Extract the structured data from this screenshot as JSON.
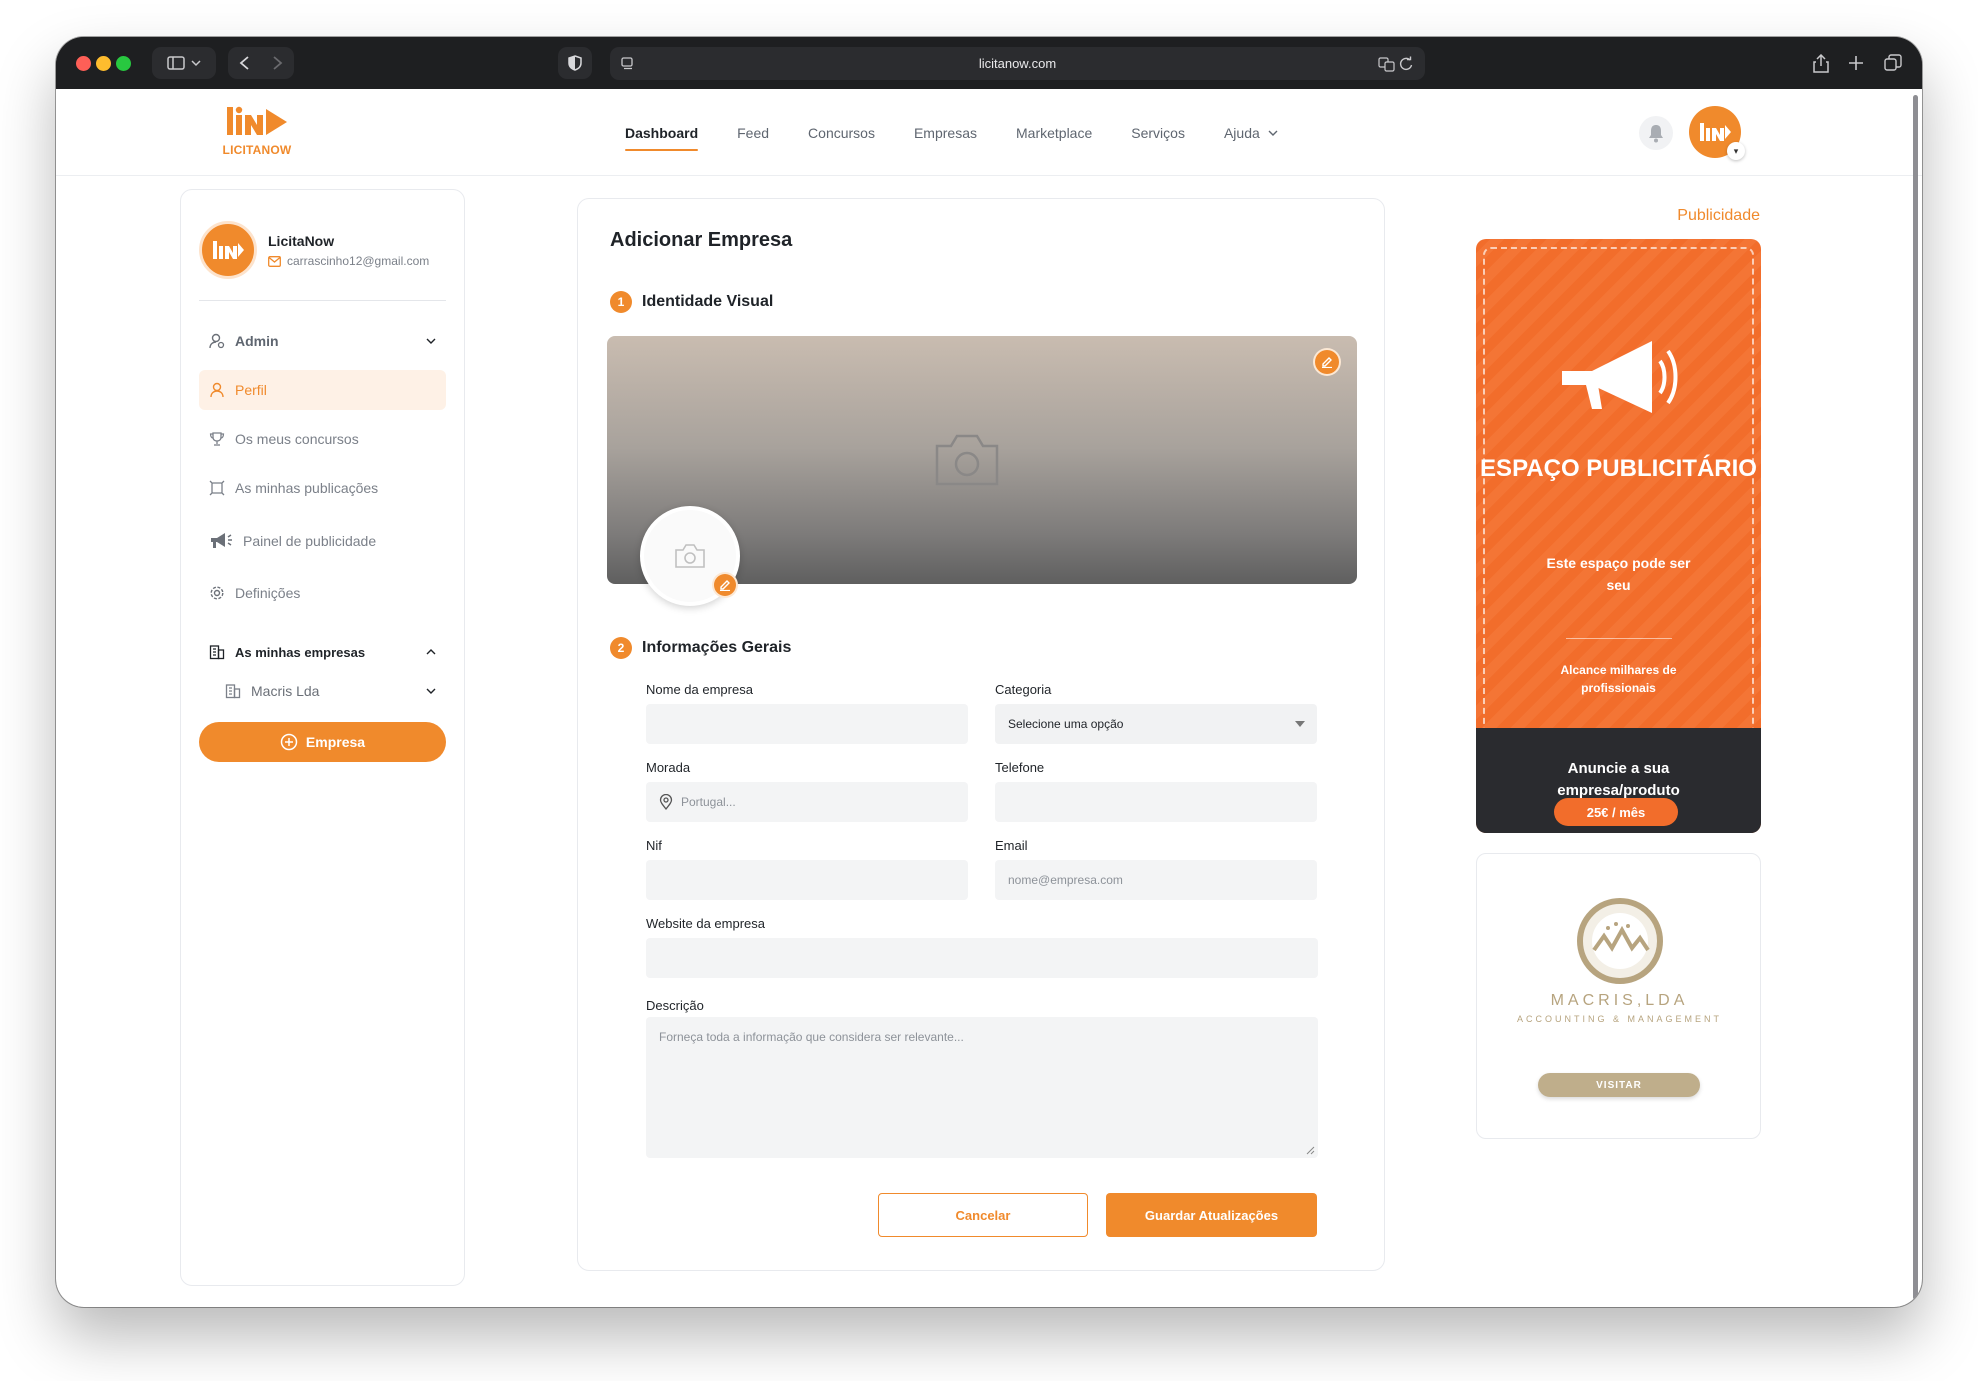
{
  "browser": {
    "url": "licitanow.com",
    "traffic_colors": [
      "#fe5f57",
      "#febc2e",
      "#28c840"
    ]
  },
  "brand": {
    "logo_text": "LICITANOW",
    "accent": "#f08a2c"
  },
  "nav": {
    "items": [
      {
        "label": "Dashboard",
        "active": true
      },
      {
        "label": "Feed",
        "active": false
      },
      {
        "label": "Concursos",
        "active": false
      },
      {
        "label": "Empresas",
        "active": false
      },
      {
        "label": "Marketplace",
        "active": false
      },
      {
        "label": "Serviços",
        "active": false
      },
      {
        "label": "Ajuda",
        "active": false
      }
    ]
  },
  "sidebar": {
    "user_name": "LicitaNow",
    "user_email": "carrascinho12@gmail.com",
    "admin_label": "Admin",
    "items": [
      {
        "label": "Perfil",
        "icon": "user-icon",
        "active": true
      },
      {
        "label": "Os meus concursos",
        "icon": "trophy-icon",
        "active": false
      },
      {
        "label": "As minhas publicações",
        "icon": "publications-icon",
        "active": false
      },
      {
        "label": "Painel de publicidade",
        "icon": "megaphone-icon",
        "active": false
      },
      {
        "label": "Definições",
        "icon": "gear-icon",
        "active": false
      }
    ],
    "companies_header": "As minhas empresas",
    "company_item": "Macris Lda",
    "add_button": "Empresa"
  },
  "form": {
    "title": "Adicionar Empresa",
    "section1": {
      "step": "1",
      "title": "Identidade Visual"
    },
    "section2": {
      "step": "2",
      "title": "Informações Gerais"
    },
    "fields": {
      "name_label": "Nome da empresa",
      "name_value": "",
      "category_label": "Categoria",
      "category_value": "Selecione uma opção",
      "address_label": "Morada",
      "address_placeholder": "Portugal...",
      "phone_label": "Telefone",
      "phone_value": "",
      "nif_label": "Nif",
      "nif_value": "",
      "email_label": "Email",
      "email_placeholder": "nome@empresa.com",
      "website_label": "Website da empresa",
      "website_value": "",
      "description_label": "Descrição",
      "description_placeholder": "Forneça toda a informação que considera ser relevante..."
    },
    "cancel_label": "Cancelar",
    "save_label": "Guardar Atualizações"
  },
  "ads": {
    "header": "Publicidade",
    "title": "ESPAÇO PUBLICITÁRIO",
    "subtitle": "Este espaço pode ser seu",
    "reach": "Alcance milhares de profissionais",
    "cta": "Anuncie a sua empresa/produto",
    "price": "25€ / mês",
    "colors": {
      "orange": "#f26d2b",
      "dark": "#2a2b2f"
    }
  },
  "sponsor": {
    "name": "MACRIS,LDA",
    "tagline": "ACCOUNTING & MANAGEMENT",
    "button": "VISITAR",
    "color": "#b7a47f"
  }
}
